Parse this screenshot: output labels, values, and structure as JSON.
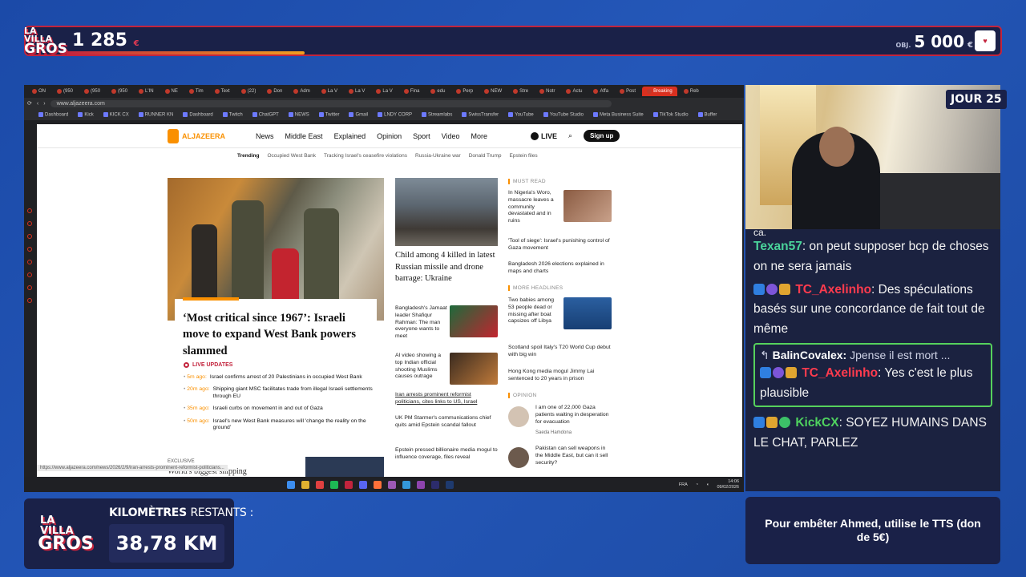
{
  "overlay": {
    "logo_line1": "LA VILLA",
    "logo_line2": "GROS",
    "counter_value": "1 285",
    "counter_unit": "€",
    "progress_fraction": 0.257,
    "goal_prefix": "OBJ.",
    "goal_value": "5 000",
    "goal_unit": "€",
    "day_label": "JOUR 25",
    "km_label_bold": "KILOMÈTRES",
    "km_label_rest": "RESTANTS :",
    "km_value": "38,78 KM",
    "tts_text": "Pour embêter Ahmed, utilise le TTS (don de 5€)",
    "brand_red": "#c3243d",
    "panel_navy": "#1a2148"
  },
  "browser": {
    "tabs": [
      "ON",
      "(950",
      "(950",
      "(950",
      "L'IN",
      "NE",
      "Tim",
      "Text",
      "(22)",
      "Don",
      "Adm",
      "La V",
      "La V",
      "La V",
      "Fina",
      "edu",
      "Perp",
      "NEW",
      "Stre",
      "Notr",
      "Actu",
      "Affa",
      "Post",
      "Breaking",
      "Reb"
    ],
    "active_tab": "Breaking",
    "url": "www.aljazeera.com",
    "bookmarks": [
      "Dashboard",
      "Kick",
      "KICK CX",
      "RUNNER KN",
      "Dashboard",
      "Twitch",
      "ChatGPT",
      "NEWS",
      "Twitter",
      "Gmail",
      "LNDY CORP",
      "Streamlabs",
      "SwissTransfer",
      "YouTube",
      "YouTube Studio",
      "Meta Business Suite",
      "TikTok Studio",
      "Buffer"
    ],
    "status_url": "https://www.aljazeera.com/news/2026/2/9/iran-arrests-prominent-reformist-politicians...",
    "clock_time": "14:06",
    "clock_date": "09/02/2026",
    "tray_lang": "FRA"
  },
  "aljazeera": {
    "logo": "ALJAZEERA",
    "nav": [
      "News",
      "Middle East",
      "Explained",
      "Opinion",
      "Sport",
      "Video",
      "More"
    ],
    "live": "LIVE",
    "signup": "Sign up",
    "trending_label": "Trending",
    "trending": [
      "Occupied West Bank",
      "Tracking Israel's ceasefire violations",
      "Russia-Ukraine war",
      "Donald Trump",
      "Epstein files"
    ],
    "lead_title": "‘Most critical since 1967’: Israeli move to expand West Bank powers slammed",
    "live_updates_label": "LIVE UPDATES",
    "updates": [
      {
        "time": "5m ago:",
        "text": "Israel confirms arrest of 20 Palestinians in occupied West Bank"
      },
      {
        "time": "20m ago:",
        "text": "Shipping giant MSC facilitates trade from illegal Israeli settlements through EU"
      },
      {
        "time": "35m ago:",
        "text": "Israeli curbs on movement in and out of Gaza"
      },
      {
        "time": "50m ago:",
        "text": "Israel's new West Bank measures will 'change the reality on the ground'"
      }
    ],
    "exclusive_label": "EXCLUSIVE",
    "exclusive_title": "World's biggest shipping",
    "mid_title": "Child among 4 killed in latest Russian missile and drone barrage: Ukraine",
    "mid_items": [
      "Bangladesh's Jamaat leader Shafiqur Rahman: The man everyone wants to meet",
      "AI video showing a top Indian official shooting Muslims causes outrage",
      "Iran arrests prominent reformist politicians, cites links to US, Israel",
      "UK PM Starmer's communications chief quits amid Epstein scandal fallout",
      "Epstein pressed billionaire media mogul to influence coverage, files reveal"
    ],
    "must_read_label": "MUST READ",
    "must_read": [
      "In Nigeria's Woro, massacre leaves a community devastated and in ruins",
      "'Tool of siege': Israel's punishing control of Gaza movement",
      "Bangladesh 2026 elections explained in maps and charts"
    ],
    "more_headlines_label": "MORE HEADLINES",
    "more_headlines": [
      "Two babies among 53 people dead or missing after boat capsizes off Libya",
      "Scotland spoil Italy's T20 World Cup debut with big win",
      "Hong Kong media mogul Jimmy Lai sentenced to 20 years in prison"
    ],
    "opinion_label": "OPINION",
    "opinion": [
      {
        "text": "I am one of 22,000 Gaza patients waiting in desperation for evacuation",
        "author": "Saeda Hamdona"
      },
      {
        "text": "Pakistan can sell weapons in the Middle East, but can it sell security?",
        "author": ""
      }
    ]
  },
  "chat": {
    "cut_text": "ca.",
    "messages": [
      {
        "user": "Texan57",
        "text": "on peut supposer bcp de choses on ne sera jamais"
      },
      {
        "user": "TC_Axelinho",
        "text": "Des spéculations basés sur une concordance de fait tout de même"
      }
    ],
    "reply": {
      "to_user": "BalinCovalex:",
      "to_text": "Jpense il est mort ...",
      "user": "TC_Axelinho",
      "text": "Yes c'est le plus plausible"
    },
    "last": {
      "user": "KickCX",
      "text": "SOYEZ HUMAINS DANS LE CHAT, PARLEZ"
    }
  }
}
